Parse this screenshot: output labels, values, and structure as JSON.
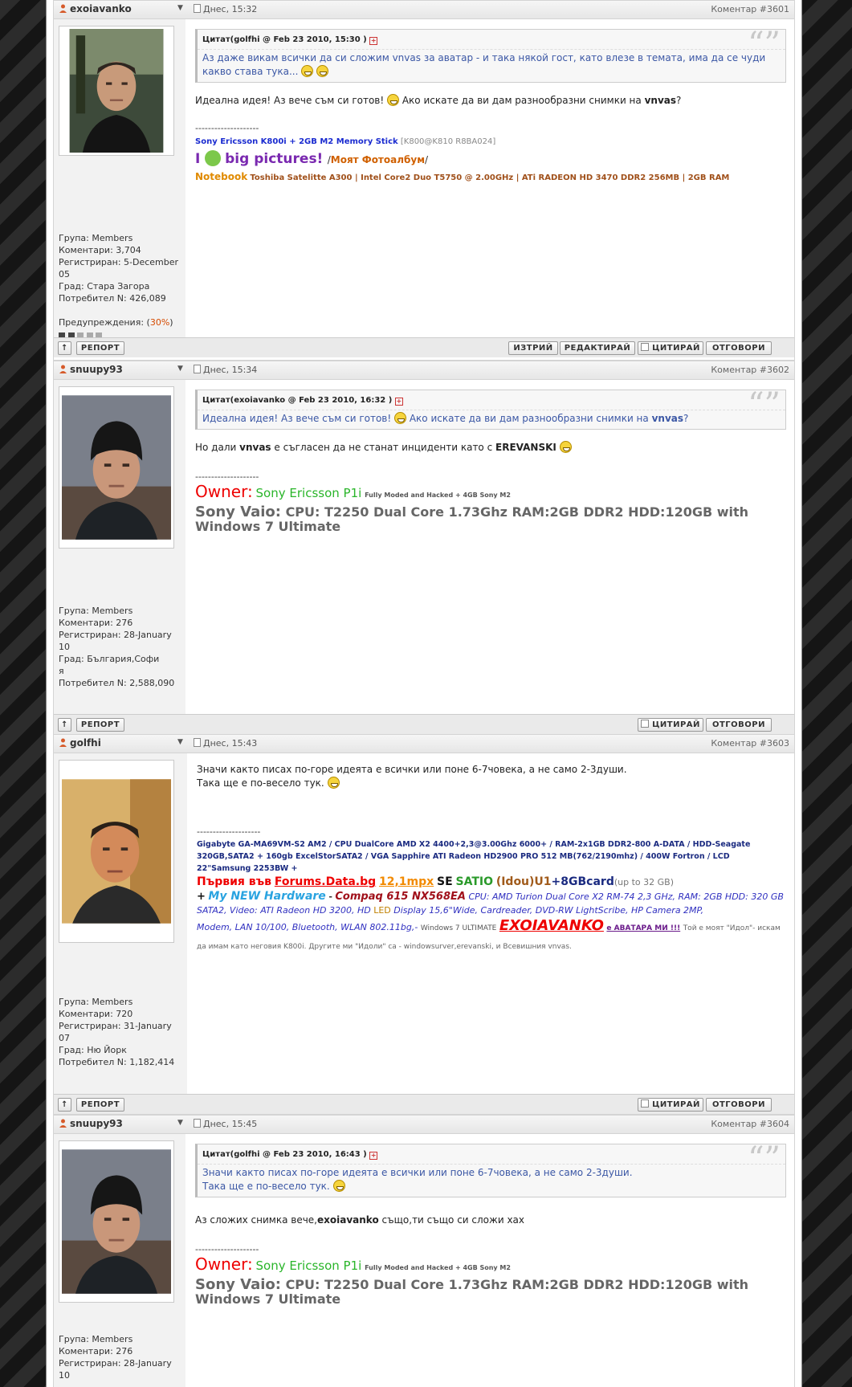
{
  "buttons": {
    "up_arrow": "↑",
    "report": "РЕПОРТ",
    "delete": "ИЗТРИЙ",
    "edit": "РЕДАКТИРАЙ",
    "quote": "ЦИТИРАЙ",
    "reply": "ОТГОВОРИ"
  },
  "posts": [
    {
      "user": "exoiavanko",
      "date": "Днес, 15:32",
      "num": "Коментар #3601",
      "stats": [
        "Група: Members",
        "Коментари: 3,704",
        "Регистриран: 5-December",
        "05",
        "Град: Стара Загора",
        "Потребител N: 426,089"
      ],
      "warn_label": "Предупреждения: (",
      "warn_value": "30%",
      "warn_close": ")",
      "quote_title": "Цитат(golfhi @ Feb 23 2010, 15:30 )",
      "quote_text": "Аз даже викам всички да си сложим vnvas за аватар - и така някой гост, като влезе в темата, има да се чуди какво става тука...",
      "body_a": "Идеална идея! Аз вече съм си готов!",
      "body_b": "Ако искате да ви дам разнообразни снимки на",
      "body_c": "vnvas",
      "body_d": "?",
      "separator": "--------------------",
      "sig_phone": "Sony Ericsson K800i + 2GB M2 Memory Stick",
      "sig_fw": "[K800@K810 R8BA024]",
      "sig_i": "I",
      "sig_big": "big pictures!",
      "sig_slash": "/",
      "sig_album": "Моят Фотоалбум",
      "sig_slash2": "/",
      "sig_nb": "Notebook",
      "sig_nbspec": "Toshiba Satelitte A300 | Intel Core2 Duo T5750 @ 2.00GHz | ATi RADEON HD 3470 DDR2 256MB | 2GB RAM"
    },
    {
      "user": "snuupy93",
      "date": "Днес, 15:34",
      "num": "Коментар #3602",
      "stats": [
        "Група: Members",
        "Коментари: 276",
        "Регистриран: 28-January",
        "10",
        "Град: България,Софи",
        "я",
        "Потребител N: 2,588,090"
      ],
      "quote_title": "Цитат(exoiavanko @ Feb 23 2010, 16:32 )",
      "quote_a": "Идеална идея! Аз вече съм си готов!",
      "quote_b": "Ако искате да ви дам разнообразни снимки на",
      "quote_c": "vnvas",
      "quote_d": "?",
      "body_a": "Но дали",
      "body_b": "vnvas",
      "body_c": "е съгласен да не станат инциденти като с",
      "body_d": "EREVANSKI",
      "separator": "--------------------",
      "owner": "Owner:",
      "owner_phone": "Sony Ericsson P1i",
      "owner_note": "Fully Moded and Hacked + 4GB Sony M2",
      "vaio": "Sony Vaio:",
      "vaio_spec": "CPU: T2250 Dual Core 1.73Ghz RAM:2GB DDR2 HDD:120GB with Windows 7 Ultimate"
    },
    {
      "user": "golfhi",
      "date": "Днес, 15:43",
      "num": "Коментар #3603",
      "stats": [
        "Група: Members",
        "Коментари: 720",
        "Регистриран: 31-January",
        "07",
        "Град: Ню Йорк",
        "Потребител N: 1,182,414"
      ],
      "body_1": "Значи както писах по-горе идеята е всички или поне 6-7човека, а не само 2-3души.",
      "body_2": "Така ще е по-весело тук.",
      "separator": "--------------------",
      "sig_hw": "Gigabyte GA-MA69VM-S2 AM2 / CPU DualCore AMD X2 4400+2,3@3.00Ghz 6000+ / RAM-2x1GB DDR2-800 A-DATA / HDD-Seagate 320GB,SATA2 + 160gb ExcelStorSATA2 / VGA Sapphire ATI Radeon HD2900 PRO 512 MB(762/2190mhz) / 400W Fortron / LCD 22\"Samsung 2253BW +",
      "sig_first": "Първия във",
      "sig_forums": "Forums.Data.bg",
      "sig_mpx": "12,1mpx",
      "sig_se": "SE",
      "sig_satio": "SATIO",
      "sig_idou": "(Idou)U1",
      "sig_card": "+8GBcard",
      "sig_upto": "(up to 32 GB)",
      "sig_plus": "+",
      "sig_new": "My NEW Hardware",
      "sig_dash": "-",
      "sig_compaq": "Compaq 615 NX568EA",
      "sig_cpu": "CPU: AMD Turion Dual Core X2 RM-74 2,3 GHz, RAM: 2GB HDD: 320 GB SATA2, Video: ATI Radeon HD 3200, HD",
      "sig_led": "LED",
      "sig_disp": "Display 15,6\"Wide, Cardreader, DVD-RW LightScribe, HP Camera 2MP,",
      "sig_modem": "Modem, LAN 10/100, Bluetooth, WLAN 802.11bg,-",
      "sig_win": "Windows 7 ULTIMATE",
      "sig_exo": "EXOIAVANKO",
      "sig_ava": "е АВАТАРА МИ !!!",
      "sig_idol": "Той е моят \"Идол\"- искам да имам като неговия K800i. Другите ми \"Идоли\" са - windowsurver,erevanski, и Всевишния vnvas."
    },
    {
      "user": "snuupy93",
      "date": "Днес, 15:45",
      "num": "Коментар #3604",
      "stats": [
        "Група: Members",
        "Коментари: 276",
        "Регистриран: 28-January",
        "10"
      ],
      "quote_title": "Цитат(golfhi @ Feb 23 2010, 16:43 )",
      "quote_1": "Значи както писах по-горе идеята е всички или поне 6-7човека, а не само 2-3души.",
      "quote_2": "Така ще е по-весело тук.",
      "body_a": "Аз сложих снимка вече,",
      "body_b": "exoiavanko",
      "body_c": "също,ти също си сложи хах",
      "separator": "--------------------",
      "owner": "Owner:",
      "owner_phone": "Sony Ericsson P1i",
      "owner_note": "Fully Moded and Hacked + 4GB Sony M2",
      "vaio": "Sony Vaio:",
      "vaio_spec": "CPU: T2250 Dual Core 1.73Ghz RAM:2GB DDR2 HDD:120GB with Windows 7 Ultimate"
    }
  ]
}
